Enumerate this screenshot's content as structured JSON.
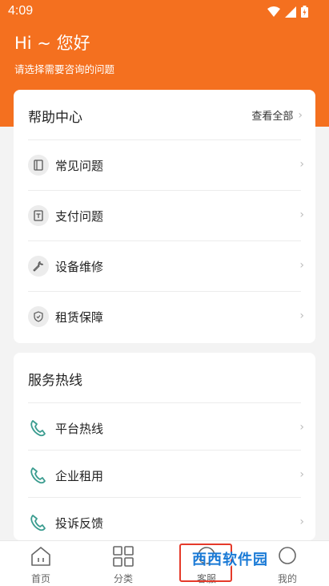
{
  "status": {
    "time": "4:09"
  },
  "header": {
    "greeting": "Hi ~ 您好",
    "subtitle": "请选择需要咨询的问题"
  },
  "help": {
    "title": "帮助中心",
    "view_all": "查看全部",
    "items": [
      {
        "label": "常见问题",
        "icon": "book-icon"
      },
      {
        "label": "支付问题",
        "icon": "payment-doc-icon"
      },
      {
        "label": "设备维修",
        "icon": "wrench-icon"
      },
      {
        "label": "租赁保障",
        "icon": "shield-icon"
      }
    ]
  },
  "hotline": {
    "title": "服务热线",
    "items": [
      {
        "label": "平台热线",
        "icon": "phone-icon"
      },
      {
        "label": "企业租用",
        "icon": "phone-icon"
      },
      {
        "label": "投诉反馈",
        "icon": "phone-icon"
      }
    ]
  },
  "tabbar": {
    "tabs": [
      {
        "label": "首页",
        "icon": "home-icon"
      },
      {
        "label": "分类",
        "icon": "grid-icon"
      },
      {
        "label": "客服",
        "icon": "chat-icon"
      },
      {
        "label": "我的",
        "icon": "profile-icon"
      }
    ]
  },
  "watermark": {
    "text": "西西软件园"
  },
  "colors": {
    "accent": "#f4701f",
    "highlight_box": "#e53a2a"
  }
}
